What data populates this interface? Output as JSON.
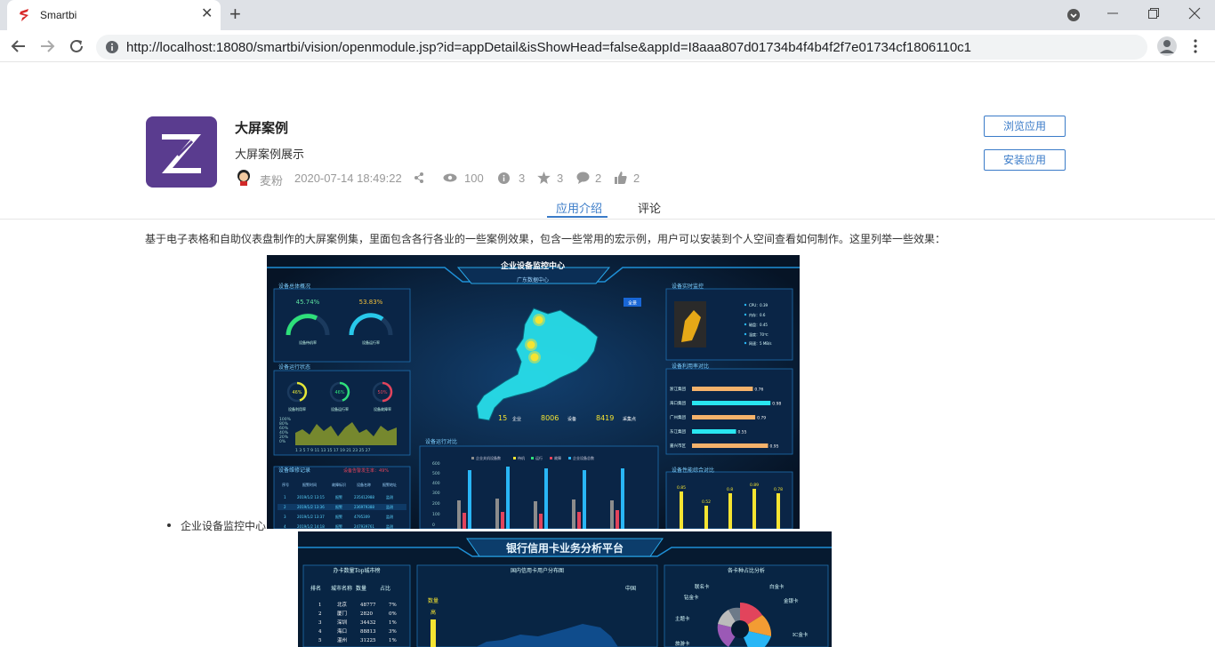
{
  "browser": {
    "tab_title": "Smartbi",
    "tab_close": "✕",
    "new_tab": "+",
    "url": "http://localhost:18080/smartbi/vision/openmodule.jsp?id=appDetail&isShowHead=false&appId=I8aaa807d01734b4f4b4f2f7e01734cf1806110c1"
  },
  "app": {
    "title": "大屏案例",
    "description": "大屏案例展示",
    "author": "麦粉",
    "timestamp": "2020-07-14 18:49:22",
    "views": "100",
    "info_count": "3",
    "stars": "3",
    "comments": "2",
    "likes": "2",
    "browse_button": "浏览应用",
    "install_button": "安装应用"
  },
  "tabs": {
    "intro": "应用介绍",
    "comments": "评论"
  },
  "content": {
    "intro_text": "基于电子表格和自助仪表盘制作的大屏案例集，里面包含各行各业的一些案例效果，包含一些常用的宏示例，用户可以安装到个人空间查看如何制作。这里列举一些效果：",
    "bullet1": "企业设备监控中心"
  },
  "dashboard1": {
    "title": "企业设备监控中心",
    "subtitle": "广东数据中心",
    "panel1": "设备总体概况",
    "gauge1": "45.74%",
    "gauge2": "53.83%",
    "gauge1_label": "设备待机率",
    "gauge2_label": "设备运行率",
    "panel2": "设备运行状态",
    "ring1": "46%",
    "ring2": "46%",
    "ring3": "50%",
    "ring1_label": "设备利用率",
    "ring2_label": "设备运行率",
    "ring3_label": "设备故障率",
    "area_y": [
      "100%",
      "80%",
      "60%",
      "40%",
      "20%",
      "0%"
    ],
    "area_x": "1 3 5 7 9 11 13 15 17 19 21 23 25 27",
    "panel3": "设备维修记录",
    "warn": "设备告警发生率：49%",
    "table_headers": [
      "序号",
      "报警时间",
      "故障标识",
      "设备名称",
      "报警地址"
    ],
    "table_rows": [
      [
        "1",
        "2019/1/2 13:15",
        "报警",
        "235412988",
        "监测"
      ],
      [
        "2",
        "2019/1/2 13:36",
        "报警",
        "236979388",
        "监测"
      ],
      [
        "3",
        "2019/1/2 13:37",
        "报警",
        "4795309",
        "监测"
      ],
      [
        "4",
        "2019/1/2 14:18",
        "报警",
        "247939761",
        "监测"
      ]
    ],
    "map_btn": "全景",
    "kpi1_value": "15",
    "kpi1_label": "企业",
    "kpi2_value": "8006",
    "kpi2_label": "设备",
    "kpi3_value": "8419",
    "kpi3_label": "采集点",
    "panel4": "设备运行对比",
    "bar_legend": [
      "企业关机设备数",
      "待机",
      "运行",
      "故障",
      "企业设备总数"
    ],
    "bar_y": [
      "600",
      "500",
      "400",
      "300",
      "200",
      "100",
      "0"
    ],
    "panel5": "设备实时监控",
    "realtime": [
      "CPU：0.39",
      "内存：0.6",
      "磁盘：0.45",
      "温度：70℃",
      "网速：5 MB/s"
    ],
    "panel6": "设备利用率对比",
    "util_rows": [
      {
        "name": "浙江集团",
        "value": 0.76
      },
      {
        "name": "海口集团",
        "value": 0.98
      },
      {
        "name": "广州集团",
        "value": 0.79
      },
      {
        "name": "东江集团",
        "value": 0.55
      },
      {
        "name": "嘉兴市区",
        "value": 0.95
      }
    ],
    "panel7": "设备性能综合对比",
    "perf_values": [
      "0.85",
      "0.52",
      "0.8",
      "0.89",
      "0.78"
    ]
  },
  "dashboard2": {
    "title": "银行信用卡业务分析平台",
    "panel1": "办卡数量Top城市榜",
    "table_headers": [
      "排名",
      "城市名称",
      "数量",
      "占比"
    ],
    "table_rows": [
      [
        "1",
        "北京",
        "48777",
        "7%"
      ],
      [
        "2",
        "厦门",
        "2820",
        "0%"
      ],
      [
        "3",
        "深圳",
        "34432",
        "1%"
      ],
      [
        "4",
        "海口",
        "88813",
        "3%"
      ],
      [
        "5",
        "温州",
        "31225",
        "1%"
      ]
    ],
    "panel2": "国内信用卡用户分布图",
    "map_legend_top": "数量",
    "map_legend_high": "高",
    "map_right": "中国",
    "panel3": "各卡种占比分析",
    "pie_labels": [
      "联名卡",
      "白金卡",
      "钻金卡",
      "金银卡",
      "主题卡",
      "旅游卡",
      "IC金卡"
    ]
  },
  "colors": {
    "accent": "#3a7bc8",
    "dash_bg": "#081a33",
    "cyan": "#29e6f0",
    "yellow": "#f5e431"
  }
}
